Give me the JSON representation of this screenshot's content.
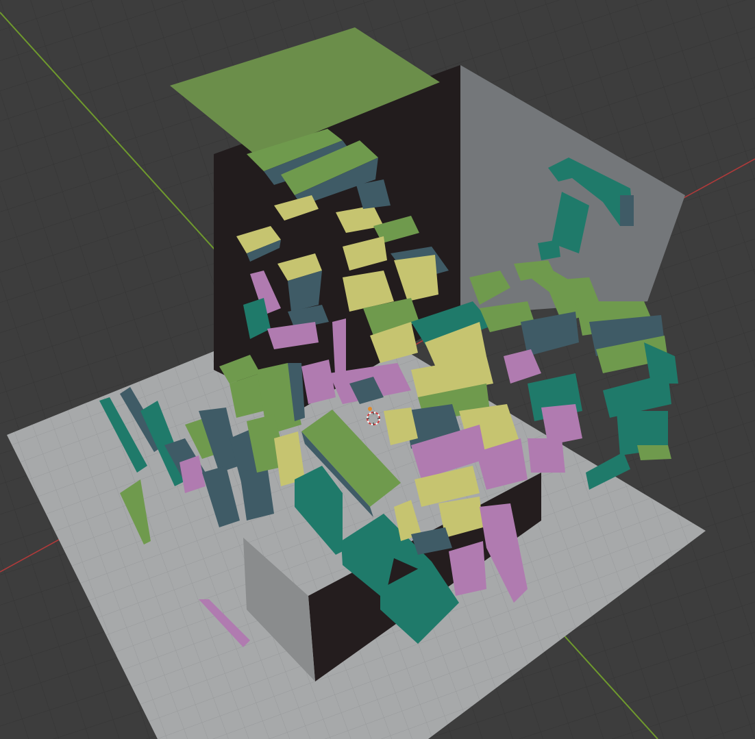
{
  "viewport": {
    "background_color": "#3d3d3d",
    "grid_color": "#353535",
    "axis_x_color": "#b03a3a",
    "axis_y_color": "#6f9a2d",
    "floor_color": "#a7a9aa",
    "floor_grid_color": "#9a9c9d",
    "back_wall_color": "#221c1d",
    "side_wall_color": "#74777a",
    "lid_color": "#6b8e4a",
    "cursor_icon": "3d-cursor-icon"
  },
  "palette": {
    "green": "#6f9a4d",
    "teal": "#1f7a6a",
    "yellow": "#c6c470",
    "pink": "#b07bb0",
    "slate": "#3f5b66"
  }
}
